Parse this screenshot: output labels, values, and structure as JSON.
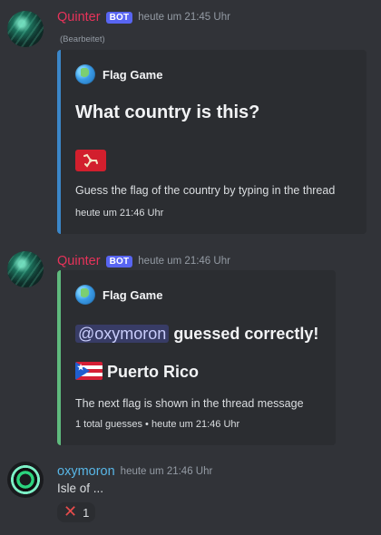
{
  "messages": [
    {
      "author": "Quinter",
      "badge": "BOT",
      "timestamp": "heute um 21:45 Uhr",
      "edited": "(Bearbeitet)",
      "embed": {
        "author_name": "Flag Game",
        "title": "What country is this?",
        "description": "Guess the flag of the country by typing in the thread",
        "footer": "heute um 21:46 Uhr",
        "accent_color": "#3b87c9"
      }
    },
    {
      "author": "Quinter",
      "badge": "BOT",
      "timestamp": "heute um 21:46 Uhr",
      "embed": {
        "author_name": "Flag Game",
        "mention": "@oxymoron",
        "title_rest": " guessed correctly!",
        "country": "Puerto Rico",
        "description": "The next flag is shown in the thread message",
        "footer": "1 total guesses • heute um 21:46 Uhr",
        "accent_color": "#5fba7d"
      }
    },
    {
      "author": "oxymoron",
      "timestamp": "heute um 21:46 Uhr",
      "content": "Isle of ...",
      "reaction": {
        "icon": "cross-mark-icon",
        "count": "1"
      }
    }
  ]
}
